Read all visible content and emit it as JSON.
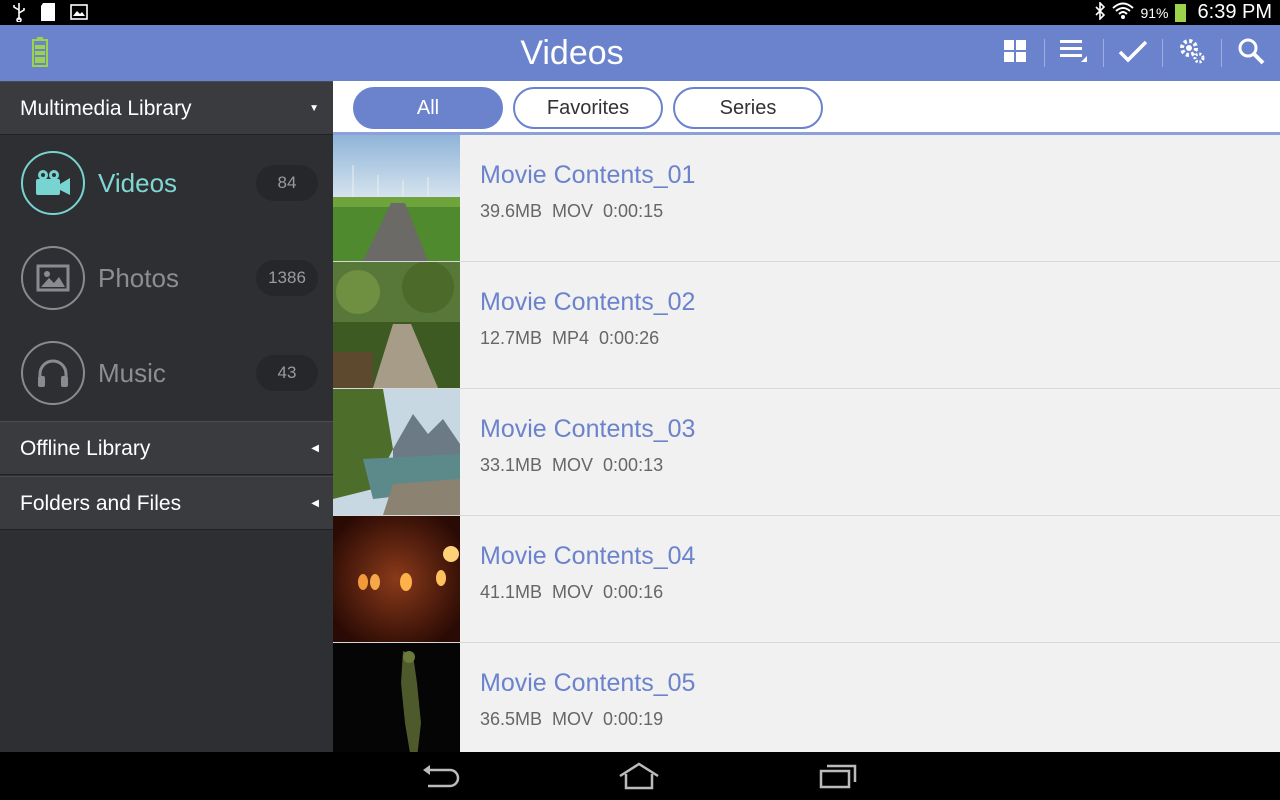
{
  "status": {
    "battery_percent": "91%",
    "time": "6:39 PM"
  },
  "titlebar": {
    "title": "Videos",
    "actions": [
      "grid-view-icon",
      "sort-icon",
      "select-check-icon",
      "settings-icon",
      "search-icon"
    ]
  },
  "sidebar": {
    "header": "Multimedia Library",
    "items": [
      {
        "label": "Videos",
        "count": "84",
        "icon": "video-camera-icon"
      },
      {
        "label": "Photos",
        "count": "1386",
        "icon": "photo-icon"
      },
      {
        "label": "Music",
        "count": "43",
        "icon": "headphones-icon"
      }
    ],
    "sections": [
      {
        "label": "Offline Library"
      },
      {
        "label": "Folders and Files"
      }
    ]
  },
  "filters": [
    "All",
    "Favorites",
    "Series"
  ],
  "videos": [
    {
      "title": "Movie Contents_01",
      "meta": "39.6MB  MOV  0:00:15"
    },
    {
      "title": "Movie Contents_02",
      "meta": "12.7MB  MP4  0:00:26"
    },
    {
      "title": "Movie Contents_03",
      "meta": "33.1MB  MOV  0:00:13"
    },
    {
      "title": "Movie Contents_04",
      "meta": "41.1MB  MOV  0:00:16"
    },
    {
      "title": "Movie Contents_05",
      "meta": "36.5MB  MOV  0:00:19"
    }
  ],
  "colors": {
    "accent": "#6b83cc",
    "active_nav": "#7fd8d4",
    "sidebar_bg": "#2e2f33"
  }
}
